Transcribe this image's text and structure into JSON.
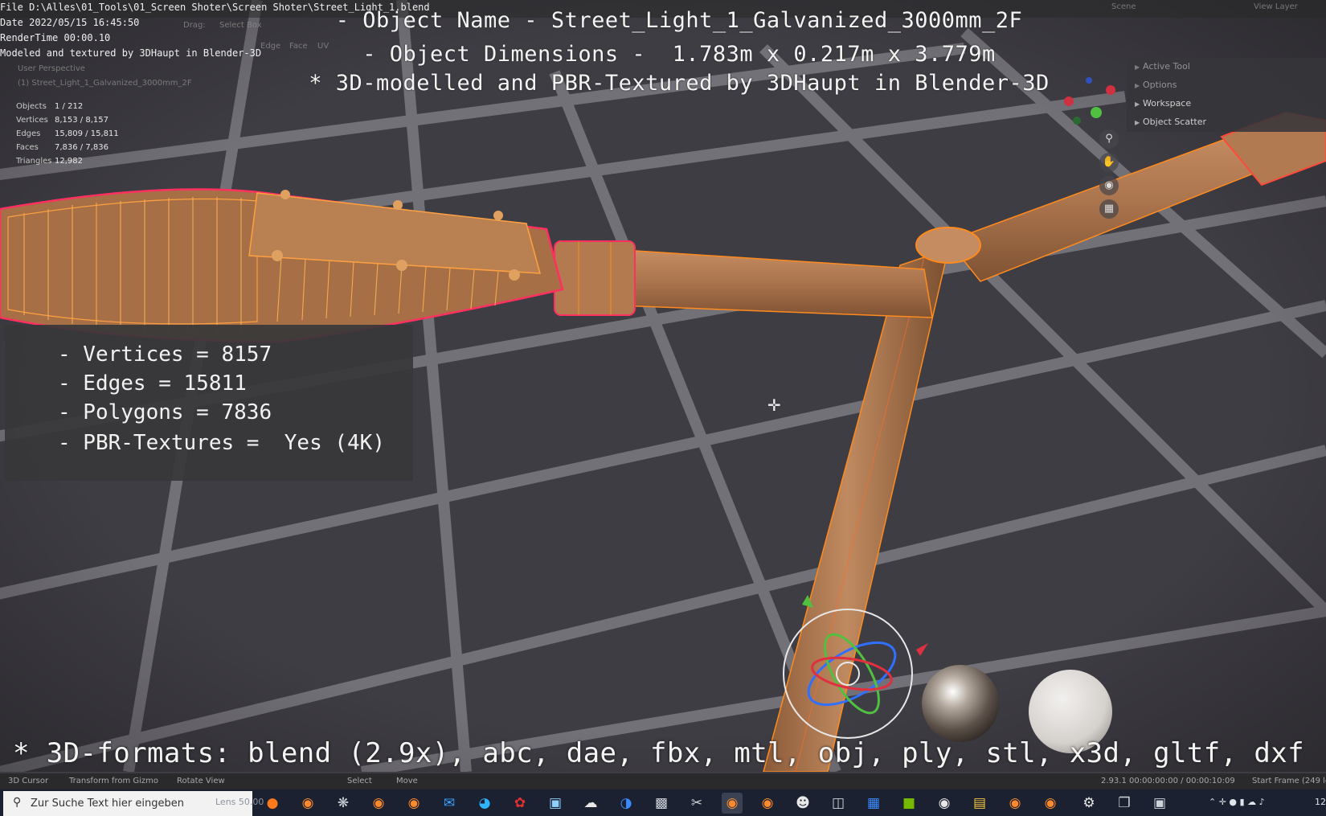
{
  "stamp": {
    "file": "File D:\\Alles\\01_Tools\\01_Screen Shoter\\Screen Shoter\\Street_Light_1.blend",
    "date": "Date 2022/05/15 16:45:50",
    "rendertime": "RenderTime 00:00.10",
    "credit": "Modeled and textured by 3DHaupt in Blender-3D"
  },
  "header": {
    "line1": "- Object Name - Street_Light_1_Galvanized_3000mm_2F",
    "line2": "- Object Dimensions -  1.783m x 0.217m x 3.779m",
    "line3": "* 3D-modelled and PBR-Textured by 3DHaupt in Blender-3D"
  },
  "viewport": {
    "perspective": "User Perspective",
    "object_label": "(1) Street_Light_1_Galvanized_3000mm_2F",
    "toolbar_ghost": [
      "Drag:",
      "Select Box",
      "Edge",
      "Face",
      "UV"
    ],
    "scene_label": "Scene",
    "view_layer_label": "View Layer",
    "stats": [
      {
        "key": "Objects",
        "value": "1 / 212"
      },
      {
        "key": "Vertices",
        "value": "8,153 / 8,157"
      },
      {
        "key": "Edges",
        "value": "15,809 / 15,811"
      },
      {
        "key": "Faces",
        "value": "7,836 / 7,836"
      },
      {
        "key": "Triangles",
        "value": "12,982"
      }
    ]
  },
  "sidepanel": {
    "items": [
      "Active Tool",
      "Options",
      "Workspace",
      "Object Scatter"
    ]
  },
  "nav_icons": [
    "zoom-icon",
    "hand-icon",
    "camera-icon",
    "grid-icon"
  ],
  "info_box": {
    "vertices": "- Vertices = 8157",
    "edges": "- Edges = 15811",
    "polygons": "- Polygons = 7836",
    "textures": "- PBR-Textures =  Yes (4K)"
  },
  "formats": "* 3D-formats: blend (2.9x), abc, dae, fbx, mtl, obj, ply, stl, x3d, gltf, dxf",
  "statusbar": {
    "cursor": "3D Cursor",
    "gizmo": "Transform from Gizmo",
    "rotate": "Rotate View",
    "select": "Select",
    "move": "Move",
    "version": "2.93.1  00:00:00:00 / 00:00:10:09",
    "frame": "Start Frame (249 le"
  },
  "taskbar": {
    "search_placeholder": "Zur Suche Text hier eingeben",
    "lens": "Lens 50.00",
    "clock": "12:"
  },
  "colors": {
    "viewport_bg": "#3f3d44",
    "pole": "#b77e53",
    "wire_orange": "#ff8a1e",
    "wire_red": "#ff3060"
  }
}
